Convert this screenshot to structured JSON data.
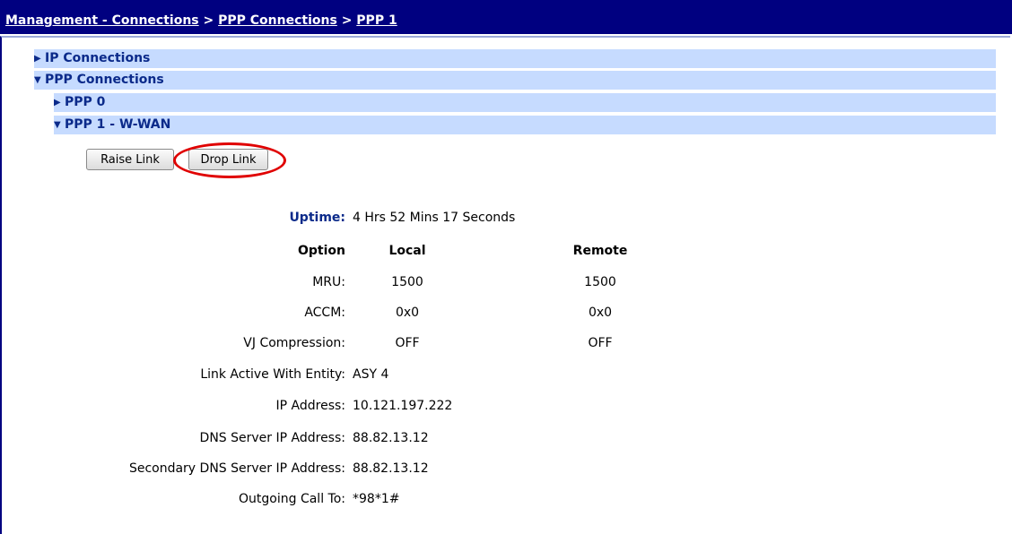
{
  "breadcrumb": {
    "items": [
      "Management - Connections",
      "PPP Connections",
      "PPP 1"
    ],
    "separator": ">"
  },
  "tree": {
    "ip_connections": "IP Connections",
    "ppp_connections": "PPP Connections",
    "ppp0": "PPP 0",
    "ppp1": "PPP 1 - W-WAN"
  },
  "buttons": {
    "raise_link": "Raise Link",
    "drop_link": "Drop Link"
  },
  "status": {
    "uptime_label": "Uptime:",
    "uptime_value": "4 Hrs 52 Mins 17 Seconds",
    "headers": {
      "option": "Option",
      "local": "Local",
      "remote": "Remote"
    },
    "rows": [
      {
        "option": "MRU:",
        "local": "1500",
        "remote": "1500"
      },
      {
        "option": "ACCM:",
        "local": "0x0",
        "remote": "0x0"
      },
      {
        "option": "VJ Compression:",
        "local": "OFF",
        "remote": "OFF"
      }
    ],
    "details": [
      {
        "label": "Link Active With Entity:",
        "value": "ASY 4"
      },
      {
        "label": "IP Address:",
        "value": "10.121.197.222"
      },
      {
        "label": "DNS Server IP Address:",
        "value": "88.82.13.12"
      },
      {
        "label": "Secondary DNS Server IP Address:",
        "value": "88.82.13.12"
      },
      {
        "label": "Outgoing Call To:",
        "value": "*98*1#"
      }
    ]
  },
  "colors": {
    "header_bg": "#000080",
    "tree_row_bg": "#c6dbff",
    "tree_text": "#0b2a8a",
    "highlight_circle": "#e00000"
  }
}
